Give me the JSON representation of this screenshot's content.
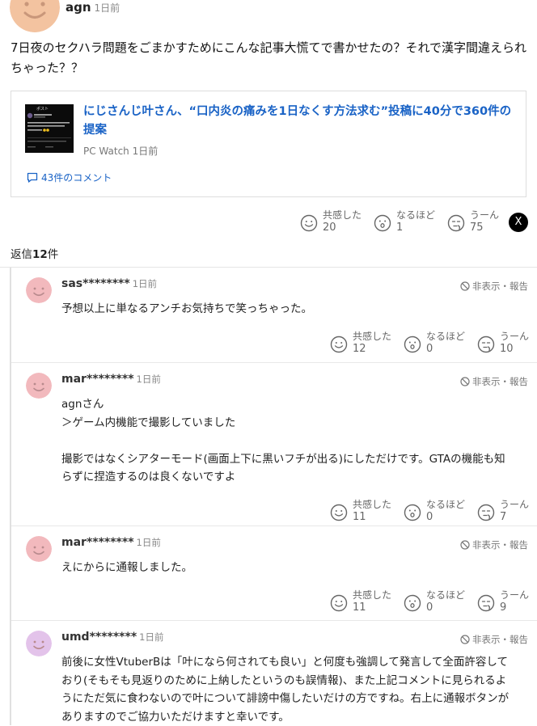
{
  "main_comment": {
    "author": "agn",
    "time": "1日前",
    "text": "7日夜のセクハラ問題をごまかすためにこんな記事大慌てで書かせたの？それで漢字間違えられちゃった？？"
  },
  "article": {
    "title": "にじさんじ叶さん、“口内炎の痛みを1日なくす方法求む”投稿に40分で360件の提案",
    "source": "PC Watch",
    "time": "1日前",
    "comment_link": "43件のコメント",
    "thumb_header": "ポスト"
  },
  "main_reactions": [
    {
      "label": "共感した",
      "count": "20"
    },
    {
      "label": "なるほど",
      "count": "1"
    },
    {
      "label": "うーん",
      "count": "75"
    }
  ],
  "share_x_label": "X",
  "replies_header": {
    "prefix": "返信",
    "count": "12",
    "suffix": "件"
  },
  "hide_label": "非表示・報告",
  "replies": [
    {
      "user": "sas********",
      "time": "1日前",
      "lines": [
        "予想以上に単なるアンチお気持ちで笑っちゃった。"
      ],
      "reactions": [
        {
          "label": "共感した",
          "count": "12"
        },
        {
          "label": "なるほど",
          "count": "0"
        },
        {
          "label": "うーん",
          "count": "10"
        }
      ]
    },
    {
      "user": "mar********",
      "time": "1日前",
      "lines": [
        "agnさん",
        "＞ゲーム内機能で撮影していました",
        "",
        "撮影ではなくシアターモード(画面上下に黒いフチが出る)にしただけです。GTAの機能も知",
        "らずに捏造するのは良くないですよ"
      ],
      "reactions": [
        {
          "label": "共感した",
          "count": "11"
        },
        {
          "label": "なるほど",
          "count": "0"
        },
        {
          "label": "うーん",
          "count": "7"
        }
      ]
    },
    {
      "user": "mar********",
      "time": "1日前",
      "lines": [
        "えにからに通報しました。"
      ],
      "reactions": [
        {
          "label": "共感した",
          "count": "11"
        },
        {
          "label": "なるほど",
          "count": "0"
        },
        {
          "label": "うーん",
          "count": "9"
        }
      ]
    },
    {
      "user": "umd********",
      "time": "1日前",
      "lines": [
        "前後に女性VtuberBは「叶になら何されても良い」と何度も強調して発言して全面許容して",
        "おり(そもそも見返りのために上納したというのも誤情報)、また上記コメントに見られるよ",
        "うにただ気に食わないので叶について誹謗中傷したいだけの方ですね。右上に通報ボタンが",
        "ありますのでご協力いただけますと幸いです。"
      ],
      "reactions": []
    }
  ],
  "colors": {
    "link": "#1a63c6",
    "avatar_main": "#f3c3a0",
    "avatar_pink": "#f2b9bd",
    "avatar_purple": "#e3c3ea"
  }
}
